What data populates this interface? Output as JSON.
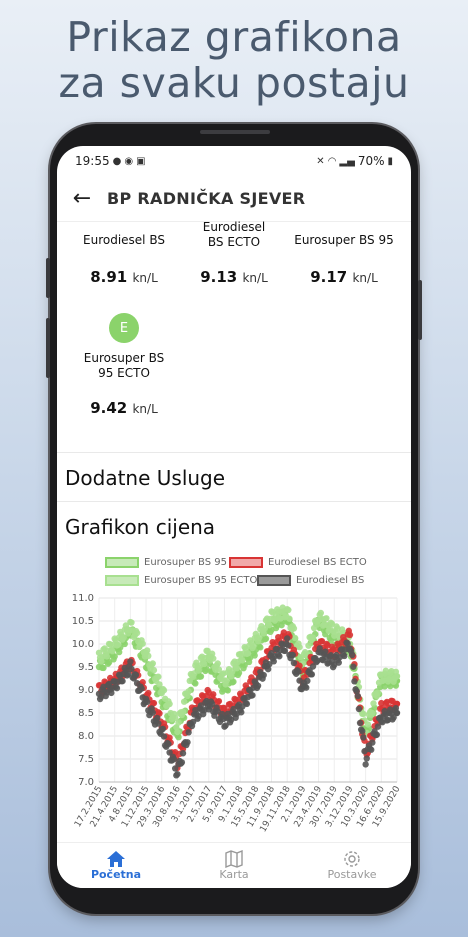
{
  "headline": [
    "Prikaz grafikona",
    "za svaku postaju"
  ],
  "status": {
    "time": "19:55",
    "battery": "70%"
  },
  "appbar": {
    "title": "BP RADNIČKA SJEVER"
  },
  "fuels": [
    {
      "name": "Eurodiesel BS",
      "price": "8.91",
      "unit": "kn/L"
    },
    {
      "name": "Eurodiesel BS ECTO",
      "price": "9.13",
      "unit": "kn/L"
    },
    {
      "name": "Eurosuper BS 95",
      "price": "9.17",
      "unit": "kn/L"
    },
    {
      "name": "Eurosuper BS 95 ECTO",
      "price": "9.42",
      "unit": "kn/L",
      "badge": "E"
    }
  ],
  "sections": {
    "services": "Dodatne Usluge",
    "chart": "Grafikon cijena"
  },
  "colors": {
    "green": "#8bd36b",
    "red": "#d83434",
    "grey": "#555555",
    "nav_active": "#2b6fd6"
  },
  "chart_data": {
    "type": "scatter",
    "ylim": [
      7.0,
      11.0
    ],
    "yticks": [
      "7.0",
      "7.5",
      "8.0",
      "8.5",
      "9.0",
      "9.5",
      "10.0",
      "10.5",
      "11.0"
    ],
    "x": [
      "17.2.2015",
      "21.4.2015",
      "4.8.2015",
      "1.12.2015",
      "29.3.2016",
      "30.8.2016",
      "3.1.2017",
      "2.5.2017",
      "5.9.2017",
      "9.1.2018",
      "15.5.2018",
      "11.9.2018",
      "19.11.2018",
      "2.1.2019",
      "23.4.2019",
      "30.7.2019",
      "3.12.2019",
      "10.3.2020",
      "16.6.2020",
      "15.9.2020"
    ],
    "series": [
      {
        "name": "Eurosuper BS 95",
        "color": "#8bd36b",
        "values": [
          9.5,
          9.8,
          10.3,
          9.6,
          8.8,
          8.0,
          9.2,
          9.6,
          9.0,
          9.5,
          9.9,
          10.4,
          10.6,
          9.4,
          10.5,
          10.1,
          9.9,
          8.0,
          9.2,
          9.2
        ]
      },
      {
        "name": "Eurodiesel BS ECTO",
        "color": "#d83434",
        "values": [
          9.0,
          9.2,
          9.6,
          8.9,
          8.3,
          7.4,
          8.6,
          8.9,
          8.5,
          8.8,
          9.3,
          9.9,
          10.2,
          9.2,
          10.0,
          9.8,
          10.2,
          7.6,
          8.6,
          8.7
        ]
      },
      {
        "name": "Eurosuper BS 95 ECTO",
        "color": "#a8e090",
        "values": [
          9.7,
          10.0,
          10.4,
          9.8,
          9.0,
          8.2,
          9.4,
          9.8,
          9.2,
          9.7,
          10.1,
          10.6,
          10.7,
          9.6,
          10.6,
          10.3,
          10.1,
          8.1,
          9.3,
          9.3
        ]
      },
      {
        "name": "Eurodiesel BS",
        "color": "#555555",
        "values": [
          8.9,
          9.1,
          9.5,
          8.7,
          8.1,
          7.2,
          8.4,
          8.7,
          8.3,
          8.6,
          9.1,
          9.7,
          10.0,
          9.0,
          9.8,
          9.6,
          10.0,
          7.5,
          8.4,
          8.5
        ]
      }
    ]
  },
  "nav": [
    {
      "label": "Početna",
      "icon": "home-icon",
      "active": true
    },
    {
      "label": "Karta",
      "icon": "map-icon",
      "active": false
    },
    {
      "label": "Postavke",
      "icon": "gear-icon",
      "active": false
    }
  ]
}
